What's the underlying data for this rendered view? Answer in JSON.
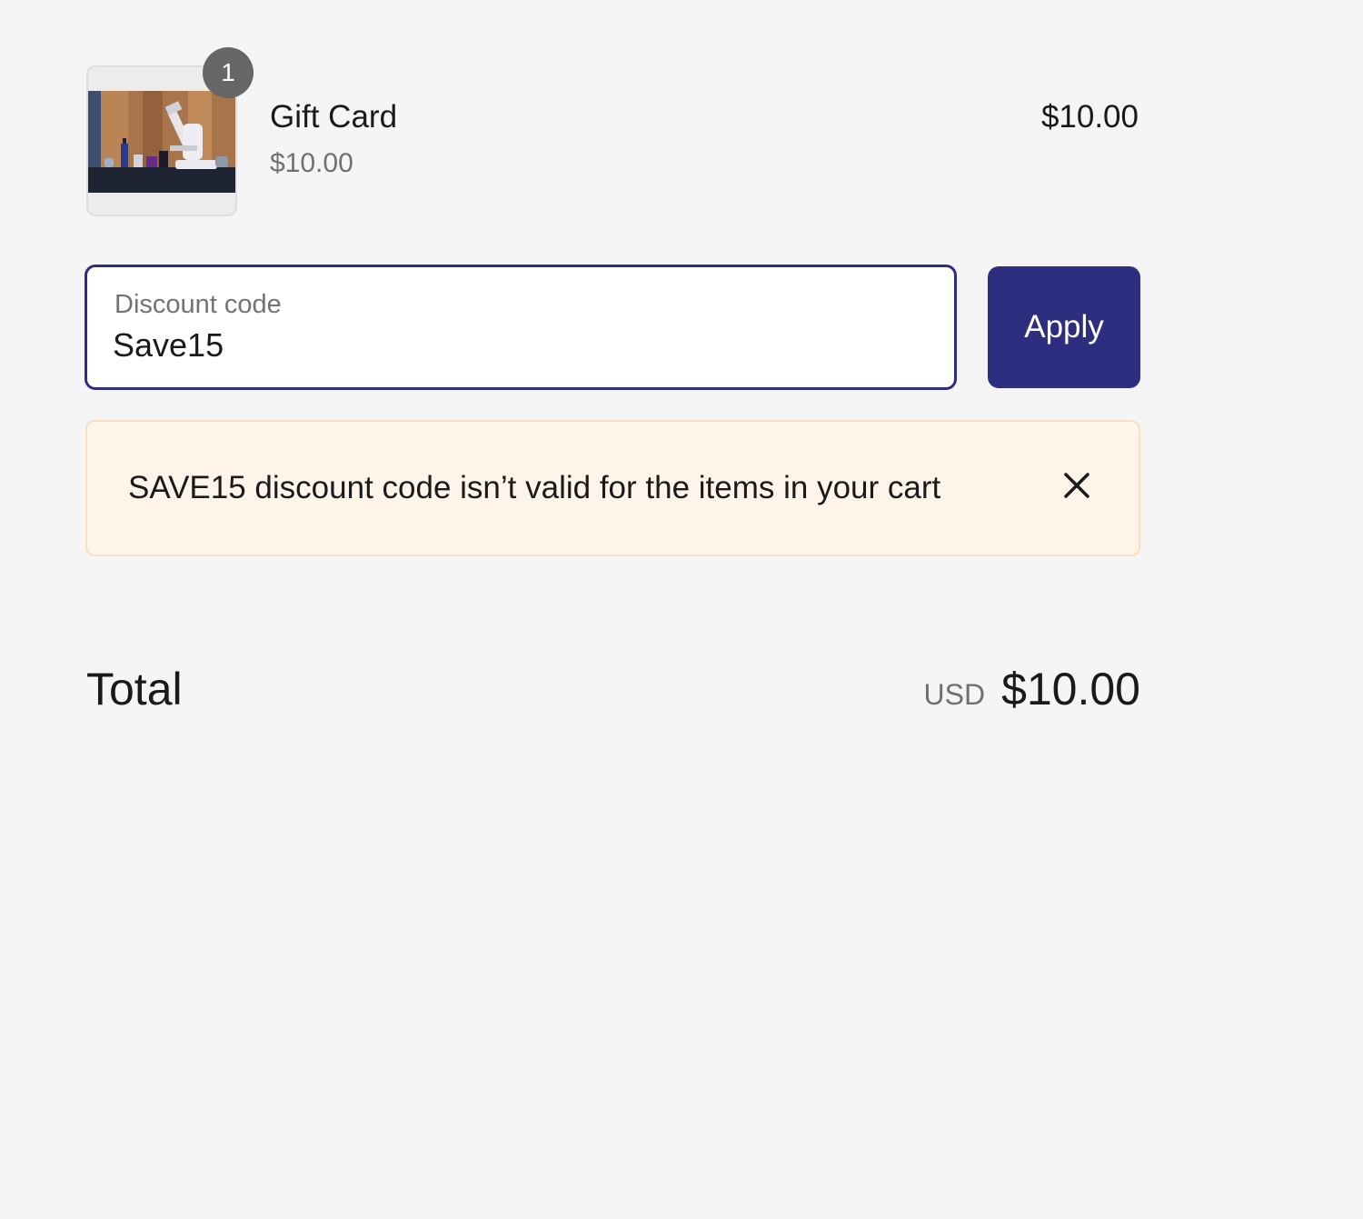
{
  "line_item": {
    "quantity": "1",
    "title": "Gift Card",
    "unit_price": "$10.00",
    "price": "$10.00",
    "image_icon": "product-photo"
  },
  "discount": {
    "label": "Discount code",
    "value": "Save15",
    "apply_label": "Apply"
  },
  "warning": {
    "message": "SAVE15 discount code isn’t valid for the items in your cart",
    "close_icon": "close-icon"
  },
  "total": {
    "label": "Total",
    "currency": "USD",
    "amount": "$10.00"
  },
  "colors": {
    "accent": "#2e2e80",
    "background": "#f5f5f5",
    "warning_bg": "#fff4e9",
    "warning_border": "#f9dfc0",
    "badge": "#666666"
  }
}
